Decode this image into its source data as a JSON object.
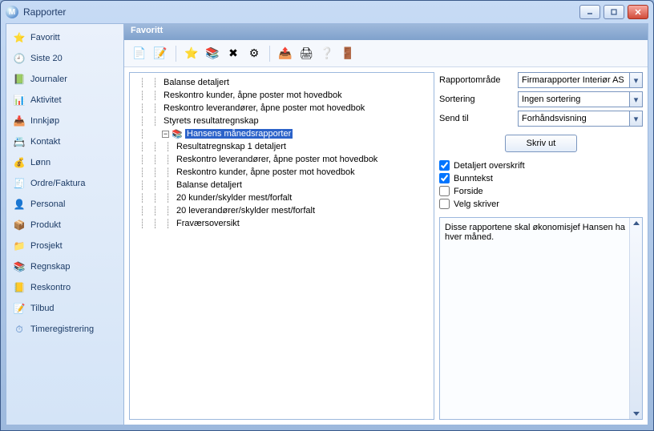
{
  "window": {
    "title": "Rapporter",
    "app_icon_letter": "M"
  },
  "sidebar": {
    "items": [
      {
        "label": "Favoritt",
        "icon": "⭐",
        "color": "#f5be2a"
      },
      {
        "label": "Siste 20",
        "icon": "🕘",
        "color": "#4a7dc1"
      },
      {
        "label": "Journaler",
        "icon": "📗",
        "color": "#3a9d4a"
      },
      {
        "label": "Aktivitet",
        "icon": "📊",
        "color": "#d96b1f"
      },
      {
        "label": "Innkjøp",
        "icon": "📥",
        "color": "#4a7dc1"
      },
      {
        "label": "Kontakt",
        "icon": "📇",
        "color": "#4a7dc1"
      },
      {
        "label": "Lønn",
        "icon": "💰",
        "color": "#d9a11f"
      },
      {
        "label": "Ordre/Faktura",
        "icon": "🧾",
        "color": "#4a7dc1"
      },
      {
        "label": "Personal",
        "icon": "👤",
        "color": "#d96b1f"
      },
      {
        "label": "Produkt",
        "icon": "📦",
        "color": "#8a6a3a"
      },
      {
        "label": "Prosjekt",
        "icon": "📁",
        "color": "#3a9d4a"
      },
      {
        "label": "Regnskap",
        "icon": "📚",
        "color": "#4a7dc1"
      },
      {
        "label": "Reskontro",
        "icon": "📒",
        "color": "#d96b1f"
      },
      {
        "label": "Tilbud",
        "icon": "📝",
        "color": "#4a7dc1"
      },
      {
        "label": "Timeregistrering",
        "icon": "⏱",
        "color": "#4a7dc1"
      }
    ]
  },
  "main": {
    "header": "Favoritt"
  },
  "toolbar": {
    "buttons": [
      {
        "name": "new-report",
        "glyph": "📄"
      },
      {
        "name": "edit-report",
        "glyph": "📝"
      },
      {
        "name": "sep"
      },
      {
        "name": "favorite",
        "glyph": "⭐"
      },
      {
        "name": "duplicate",
        "glyph": "📚"
      },
      {
        "name": "delete",
        "glyph": "✖",
        "color": "#000"
      },
      {
        "name": "settings",
        "glyph": "⚙"
      },
      {
        "name": "sep"
      },
      {
        "name": "export",
        "glyph": "📤"
      },
      {
        "name": "print",
        "glyph": "🖨"
      },
      {
        "name": "help",
        "glyph": "❔",
        "color": "#2d6cc0"
      },
      {
        "name": "exit",
        "glyph": "🚪"
      }
    ]
  },
  "tree": {
    "root": [
      {
        "label": "Balanse detaljert"
      },
      {
        "label": "Reskontro kunder, åpne poster mot hovedbok"
      },
      {
        "label": "Reskontro leverandører, åpne poster mot hovedbok"
      },
      {
        "label": "Styrets resultatregnskap"
      },
      {
        "label": "Hansens månedsrapporter",
        "expanded": true,
        "selected": true,
        "folder": true,
        "children": [
          {
            "label": "Resultatregnskap 1 detaljert"
          },
          {
            "label": "Reskontro leverandører, åpne poster mot hovedbok"
          },
          {
            "label": "Reskontro kunder, åpne poster mot hovedbok"
          },
          {
            "label": "Balanse detaljert"
          },
          {
            "label": "20 kunder/skylder mest/forfalt"
          },
          {
            "label": "20 leverandører/skylder mest/forfalt"
          },
          {
            "label": "Fraværsoversikt"
          }
        ]
      }
    ]
  },
  "props": {
    "labels": {
      "rapportomrade": "Rapportområde",
      "sortering": "Sortering",
      "send_til": "Send til"
    },
    "values": {
      "rapportomrade": "Firmarapporter Interiør AS",
      "sortering": "Ingen sortering",
      "send_til": "Forhåndsvisning"
    },
    "print_button": "Skriv ut",
    "checks": {
      "detaljert": {
        "label": "Detaljert overskrift",
        "checked": true
      },
      "bunntekst": {
        "label": "Bunntekst",
        "checked": true
      },
      "forside": {
        "label": "Forside",
        "checked": false
      },
      "velg_skriver": {
        "label": "Velg skriver",
        "checked": false
      }
    },
    "description": "Disse rapportene skal økonomisjef Hansen ha hver måned."
  }
}
